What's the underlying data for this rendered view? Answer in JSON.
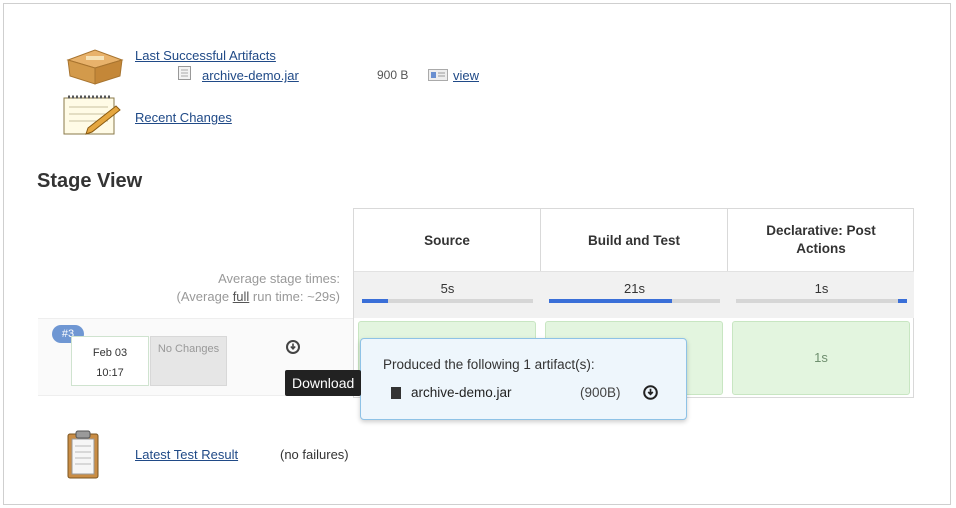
{
  "artifacts": {
    "title": "Last Successful Artifacts",
    "file_name": "archive-demo.jar",
    "file_size": "900 B",
    "view_label": "view"
  },
  "recent_changes": {
    "label": "Recent Changes"
  },
  "stage_view": {
    "title": "Stage View",
    "stages": [
      {
        "name": "Source",
        "avg_time": "5s",
        "avg_fill": 0.15
      },
      {
        "name": "Build and Test",
        "avg_time": "21s",
        "avg_fill": 0.72
      },
      {
        "name": "Declarative: Post Actions",
        "avg_time": "1s",
        "avg_fill": 0.05
      }
    ],
    "avg_label": "Average stage times:",
    "avg_full_prefix": "(Average ",
    "avg_full_word": "full",
    "avg_full_suffix": " run time: ~29s)",
    "run": {
      "badge": "#3",
      "date": "Feb 03",
      "time": "10:17",
      "changes": "No Changes",
      "cells": [
        "",
        "",
        "1s"
      ]
    }
  },
  "tooltip": {
    "text": "Download"
  },
  "popover": {
    "title": "Produced the following 1 artifact(s):",
    "file_name": "archive-demo.jar",
    "file_size": "(900B)"
  },
  "test_result": {
    "link": "Latest Test Result",
    "note": "(no failures)"
  },
  "colors": {
    "link": "#204a87",
    "success_cell": "#e3f5df",
    "progress": "#3a6fd8",
    "badge": "#6f97d3",
    "popover_bg": "#eef6fc"
  }
}
